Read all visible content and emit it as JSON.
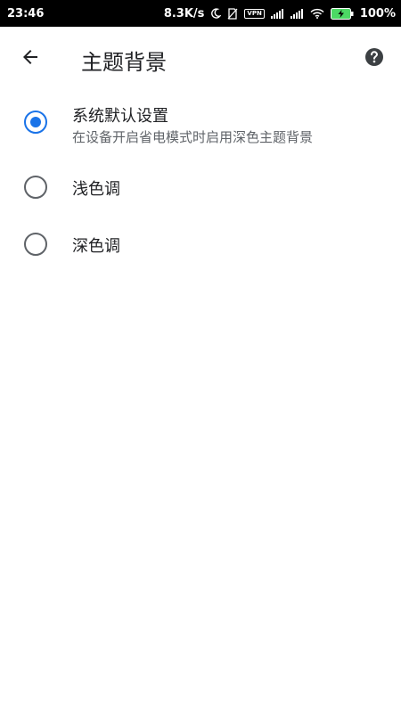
{
  "status_bar": {
    "time": "23:46",
    "net_speed": "8.3K/s",
    "vpn": "VPN",
    "battery": "100%"
  },
  "header": {
    "title": "主题背景"
  },
  "options": [
    {
      "label": "系统默认设置",
      "sublabel": "在设备开启省电模式时启用深色主题背景",
      "selected": true
    },
    {
      "label": "浅色调",
      "selected": false
    },
    {
      "label": "深色调",
      "selected": false
    }
  ],
  "colors": {
    "accent": "#1a73e8",
    "text_primary": "#202124",
    "text_secondary": "#5f6368",
    "status_bar_bg": "#000000",
    "battery_fill": "#4cd964"
  }
}
